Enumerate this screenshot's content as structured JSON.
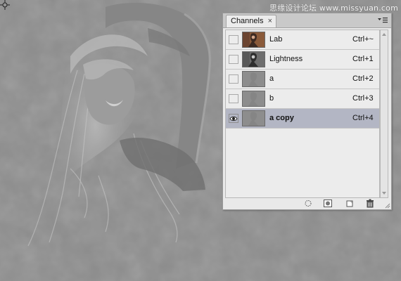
{
  "watermark": "思缘设计论坛 www.missyuan.com",
  "panel": {
    "tab_label": "Channels",
    "close_glyph": "×",
    "menu_icon": "panel-menu-icon",
    "channels": [
      {
        "name": "Lab",
        "shortcut": "Ctrl+~",
        "thumb": "color",
        "visible": false,
        "selected": false
      },
      {
        "name": "Lightness",
        "shortcut": "Ctrl+1",
        "thumb": "lightness",
        "visible": false,
        "selected": false
      },
      {
        "name": "a",
        "shortcut": "Ctrl+2",
        "thumb": "gray",
        "visible": false,
        "selected": false
      },
      {
        "name": "b",
        "shortcut": "Ctrl+3",
        "thumb": "gray",
        "visible": false,
        "selected": false
      },
      {
        "name": "a copy",
        "shortcut": "Ctrl+4",
        "thumb": "gray",
        "visible": true,
        "selected": true
      }
    ],
    "bottom_icons": [
      "load-selection-icon",
      "save-selection-icon",
      "new-channel-icon",
      "delete-channel-icon"
    ]
  },
  "colors": {
    "canvas_bg": "#8f8f8f",
    "selected_row": "#b3b6c4",
    "panel_bg": "#e9e9e9"
  }
}
